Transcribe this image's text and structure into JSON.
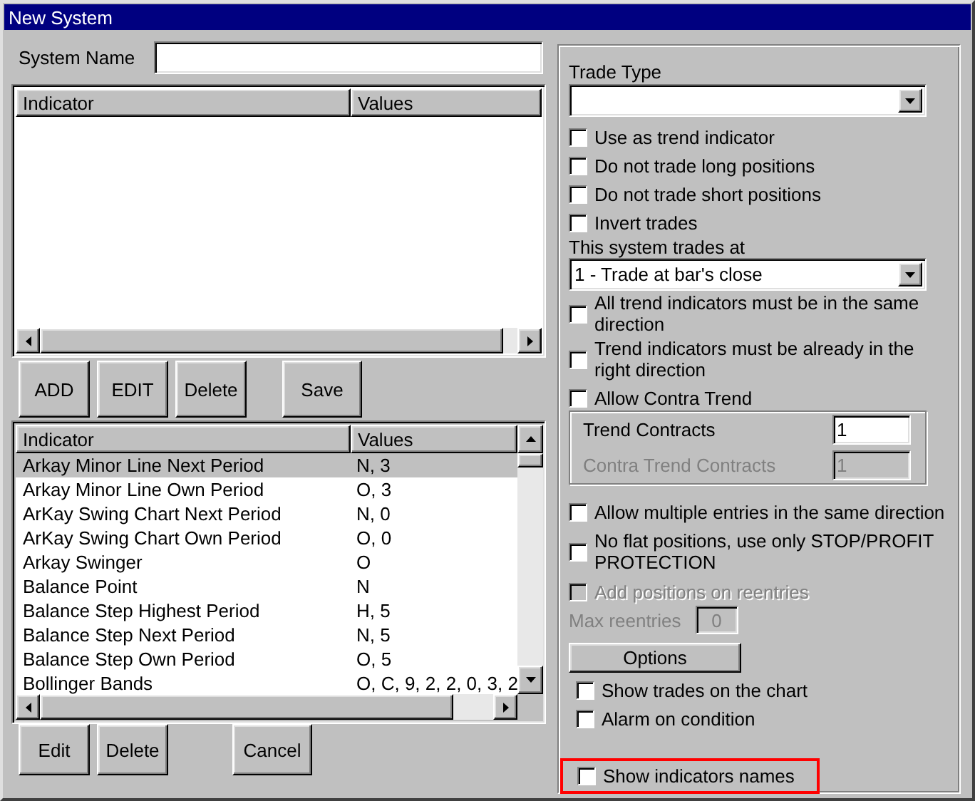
{
  "window": {
    "title": "New System"
  },
  "system_name": {
    "label": "System Name"
  },
  "indicator_table": {
    "columns": [
      "Indicator",
      "Values"
    ]
  },
  "top_buttons": [
    "ADD",
    "EDIT",
    "Delete",
    "Save"
  ],
  "library_table": {
    "columns": [
      "Indicator",
      "Values"
    ],
    "rows": [
      {
        "indicator": "Arkay Minor Line Next Period",
        "values": "N, 3",
        "selected": true
      },
      {
        "indicator": "Arkay Minor Line Own Period",
        "values": "O, 3",
        "selected": false
      },
      {
        "indicator": "ArKay Swing Chart Next Period",
        "values": "N, 0",
        "selected": false
      },
      {
        "indicator": "ArKay Swing Chart Own Period",
        "values": "O, 0",
        "selected": false
      },
      {
        "indicator": "Arkay Swinger",
        "values": "O",
        "selected": false
      },
      {
        "indicator": "Balance Point",
        "values": "N",
        "selected": false
      },
      {
        "indicator": "Balance Step Highest Period",
        "values": "H, 5",
        "selected": false
      },
      {
        "indicator": "Balance Step Next Period",
        "values": "N, 5",
        "selected": false
      },
      {
        "indicator": "Balance Step Own Period",
        "values": "O, 5",
        "selected": false
      },
      {
        "indicator": "Bollinger Bands",
        "values": "O, C, 9, 2, 2, 0, 3, 2",
        "selected": false
      }
    ]
  },
  "bottom_buttons": [
    "Edit",
    "Delete",
    "Cancel"
  ],
  "trade_type": {
    "label": "Trade Type"
  },
  "trade_options": [
    {
      "label": "Use as trend indicator",
      "checked": false
    },
    {
      "label": "Do not trade long positions",
      "checked": false
    },
    {
      "label": "Do not trade short positions",
      "checked": false
    },
    {
      "label": "Invert trades",
      "checked": false
    }
  ],
  "trades_at": {
    "label": "This system trades at",
    "value": "1 - Trade at bar's close"
  },
  "trend_options": [
    {
      "label": "All trend indicators must be in the same direction",
      "checked": false
    },
    {
      "label": "Trend indicators must be already in the right direction",
      "checked": false
    }
  ],
  "contra_trend": {
    "label": "Allow Contra Trend",
    "checked": false,
    "fields": [
      {
        "label": "Trend Contracts",
        "value": "1",
        "disabled": false
      },
      {
        "label": "Contra Trend Contracts",
        "value": "1",
        "disabled": true
      }
    ]
  },
  "entry_options": [
    {
      "label": "Allow multiple entries in the same direction",
      "checked": false,
      "disabled": false
    },
    {
      "label": "No flat positions, use only STOP/PROFIT PROTECTION",
      "checked": false,
      "disabled": false
    },
    {
      "label": "Add positions on reentries",
      "checked": false,
      "disabled": true
    }
  ],
  "max_reentries": {
    "label": "Max reentries",
    "value": "0",
    "disabled": true
  },
  "options_button": "Options",
  "chart_options": [
    {
      "label": "Show trades on the chart",
      "checked": false
    },
    {
      "label": "Alarm on condition",
      "checked": false
    }
  ],
  "show_names": {
    "label": "Show indicators names",
    "checked": false,
    "highlighted": true
  }
}
